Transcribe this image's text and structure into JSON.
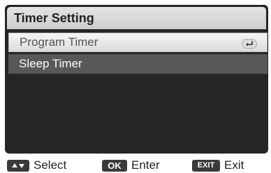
{
  "menu": {
    "title": "Timer Setting",
    "items": [
      {
        "label": "Program Timer",
        "selected": true,
        "icon": "enter-return-icon"
      },
      {
        "label": "Sleep Timer",
        "selected": false
      }
    ]
  },
  "footer": {
    "select": {
      "key_icon": "up-down-arrows-icon",
      "label": "Select"
    },
    "enter": {
      "key": "OK",
      "label": "Enter"
    },
    "exit": {
      "key": "EXIT",
      "label": "Exit"
    }
  },
  "colors": {
    "screen_bg": "#262626",
    "highlight_bar": "#585858",
    "selected_item": "#e9e9e9"
  }
}
